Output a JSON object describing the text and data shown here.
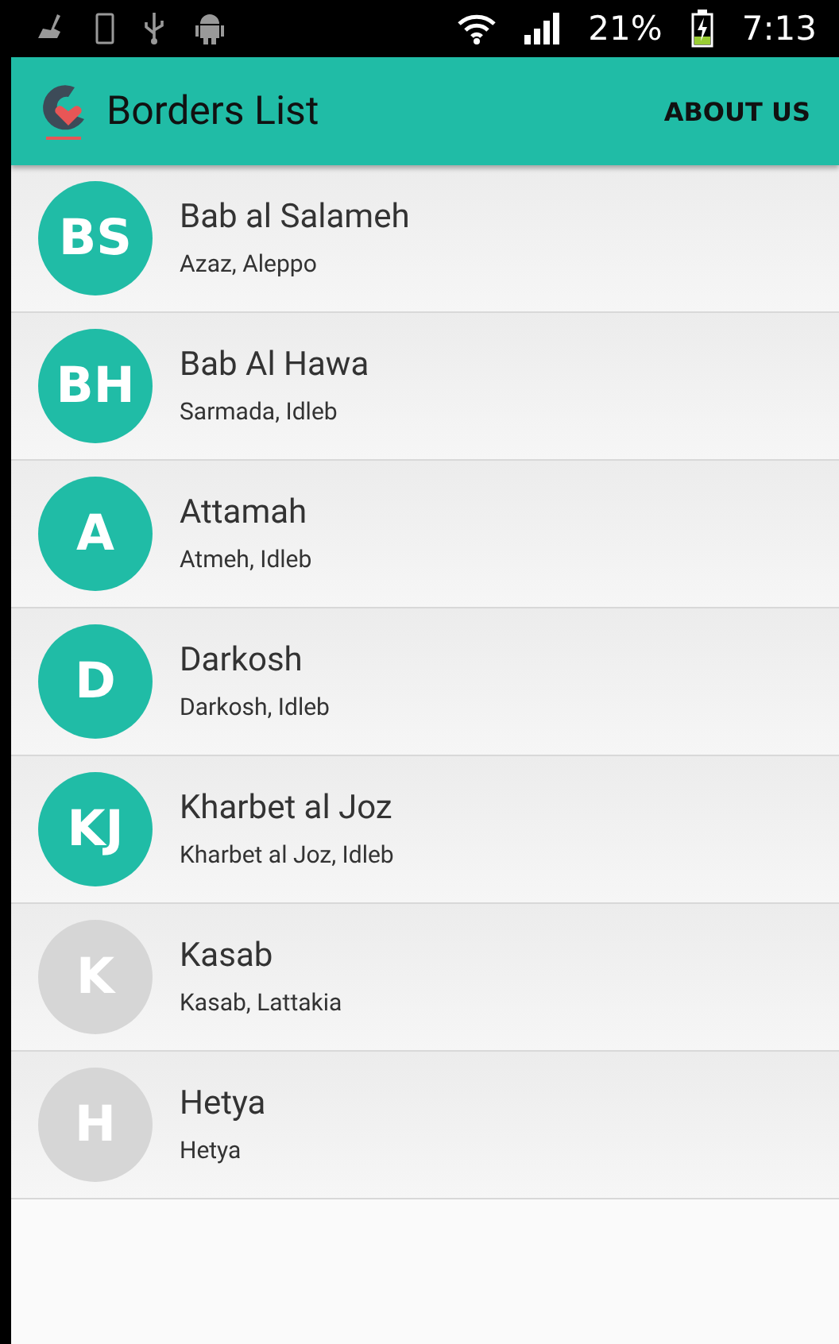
{
  "status_bar": {
    "battery": "21%",
    "time": "7:13"
  },
  "app_bar": {
    "title": "Borders List",
    "action": "ABOUT US"
  },
  "borders": [
    {
      "initials": "BS",
      "name": "Bab al Salameh",
      "location": "Azaz, Aleppo",
      "color": "#20bca6"
    },
    {
      "initials": "BH",
      "name": "Bab Al Hawa",
      "location": "Sarmada, Idleb",
      "color": "#20bca6"
    },
    {
      "initials": "A",
      "name": "Attamah",
      "location": "Atmeh, Idleb",
      "color": "#20bca6"
    },
    {
      "initials": "D",
      "name": "Darkosh",
      "location": "Darkosh, Idleb",
      "color": "#20bca6"
    },
    {
      "initials": "KJ",
      "name": "Kharbet al Joz",
      "location": "Kharbet al Joz, Idleb",
      "color": "#20bca6"
    },
    {
      "initials": "K",
      "name": "Kasab",
      "location": "Kasab, Lattakia",
      "color": "#d6d6d6"
    },
    {
      "initials": "H",
      "name": "Hetya",
      "location": "Hetya",
      "color": "#d6d6d6"
    }
  ]
}
